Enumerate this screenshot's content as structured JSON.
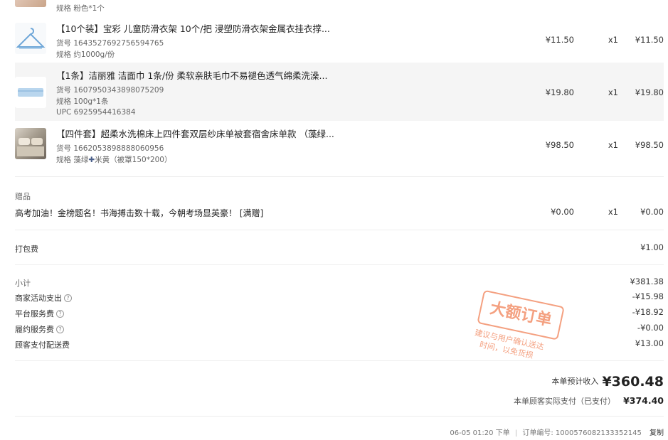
{
  "items": [
    {
      "title": "",
      "huohao": "",
      "spec": "规格 粉色*1个",
      "upc": "",
      "price": "",
      "qty": "",
      "total": ""
    },
    {
      "title": "【10个装】宝彩 儿童防滑衣架 10个/把 浸塑防滑衣架金属衣挂衣撑...",
      "huohao": "货号 1643527692756594765",
      "spec": "规格 约1000g/份",
      "upc": "",
      "price": "¥11.50",
      "qty": "x1",
      "total": "¥11.50"
    },
    {
      "title": "【1条】洁丽雅 洁面巾 1条/份 柔软亲肤毛巾不易褪色透气绵柔洗澡...",
      "huohao": "货号 1607950343898075209",
      "spec": "规格 100g*1条",
      "upc": "UPC 6925954416384",
      "price": "¥19.80",
      "qty": "x1",
      "total": "¥19.80"
    },
    {
      "title": "【四件套】超柔水洗棉床上四件套双层纱床单被套宿舍床单款 （藻绿...",
      "huohao": "货号 1662053898888060956",
      "spec_prefix": "规格 藻绿",
      "spec_plus": "✚",
      "spec_suffix": "米黄（被罩150*200）",
      "price": "¥98.50",
      "qty": "x1",
      "total": "¥98.50"
    }
  ],
  "gift": {
    "section_label": "赠品",
    "text": "高考加油！金榜题名！书海搏击数十载，今朝考场显英豪！ [满赠]",
    "price": "¥0.00",
    "qty": "x1",
    "total": "¥0.00"
  },
  "packing": {
    "label": "打包费",
    "value": "¥1.00"
  },
  "summary": [
    {
      "label": "小计",
      "value": "¥381.38",
      "help": false
    },
    {
      "label": "商家活动支出",
      "value": "-¥15.98",
      "help": true
    },
    {
      "label": "平台服务费",
      "value": "-¥18.92",
      "help": true
    },
    {
      "label": "履约服务费",
      "value": "-¥0.00",
      "help": true
    },
    {
      "label": "顾客支付配送费",
      "value": "¥13.00",
      "help": false
    }
  ],
  "totals": {
    "income_label": "本单预计收入",
    "income_value": "¥360.48",
    "paid_label": "本单顾客实际支付（已支付）",
    "paid_value": "¥374.40"
  },
  "footer": {
    "time": "06-05 01:20 下单",
    "divider": "|",
    "order_label": "订单编号:",
    "order_no": "1000576082133352145",
    "copy": "复制"
  },
  "stamp": {
    "title": "大额订单",
    "line1": "建议与用户确认送达",
    "line2": "时间，以免货损"
  },
  "help_glyph": "?",
  "colors": {
    "stamp": "#f07c50",
    "row_highlight": "#f5f5f5"
  }
}
